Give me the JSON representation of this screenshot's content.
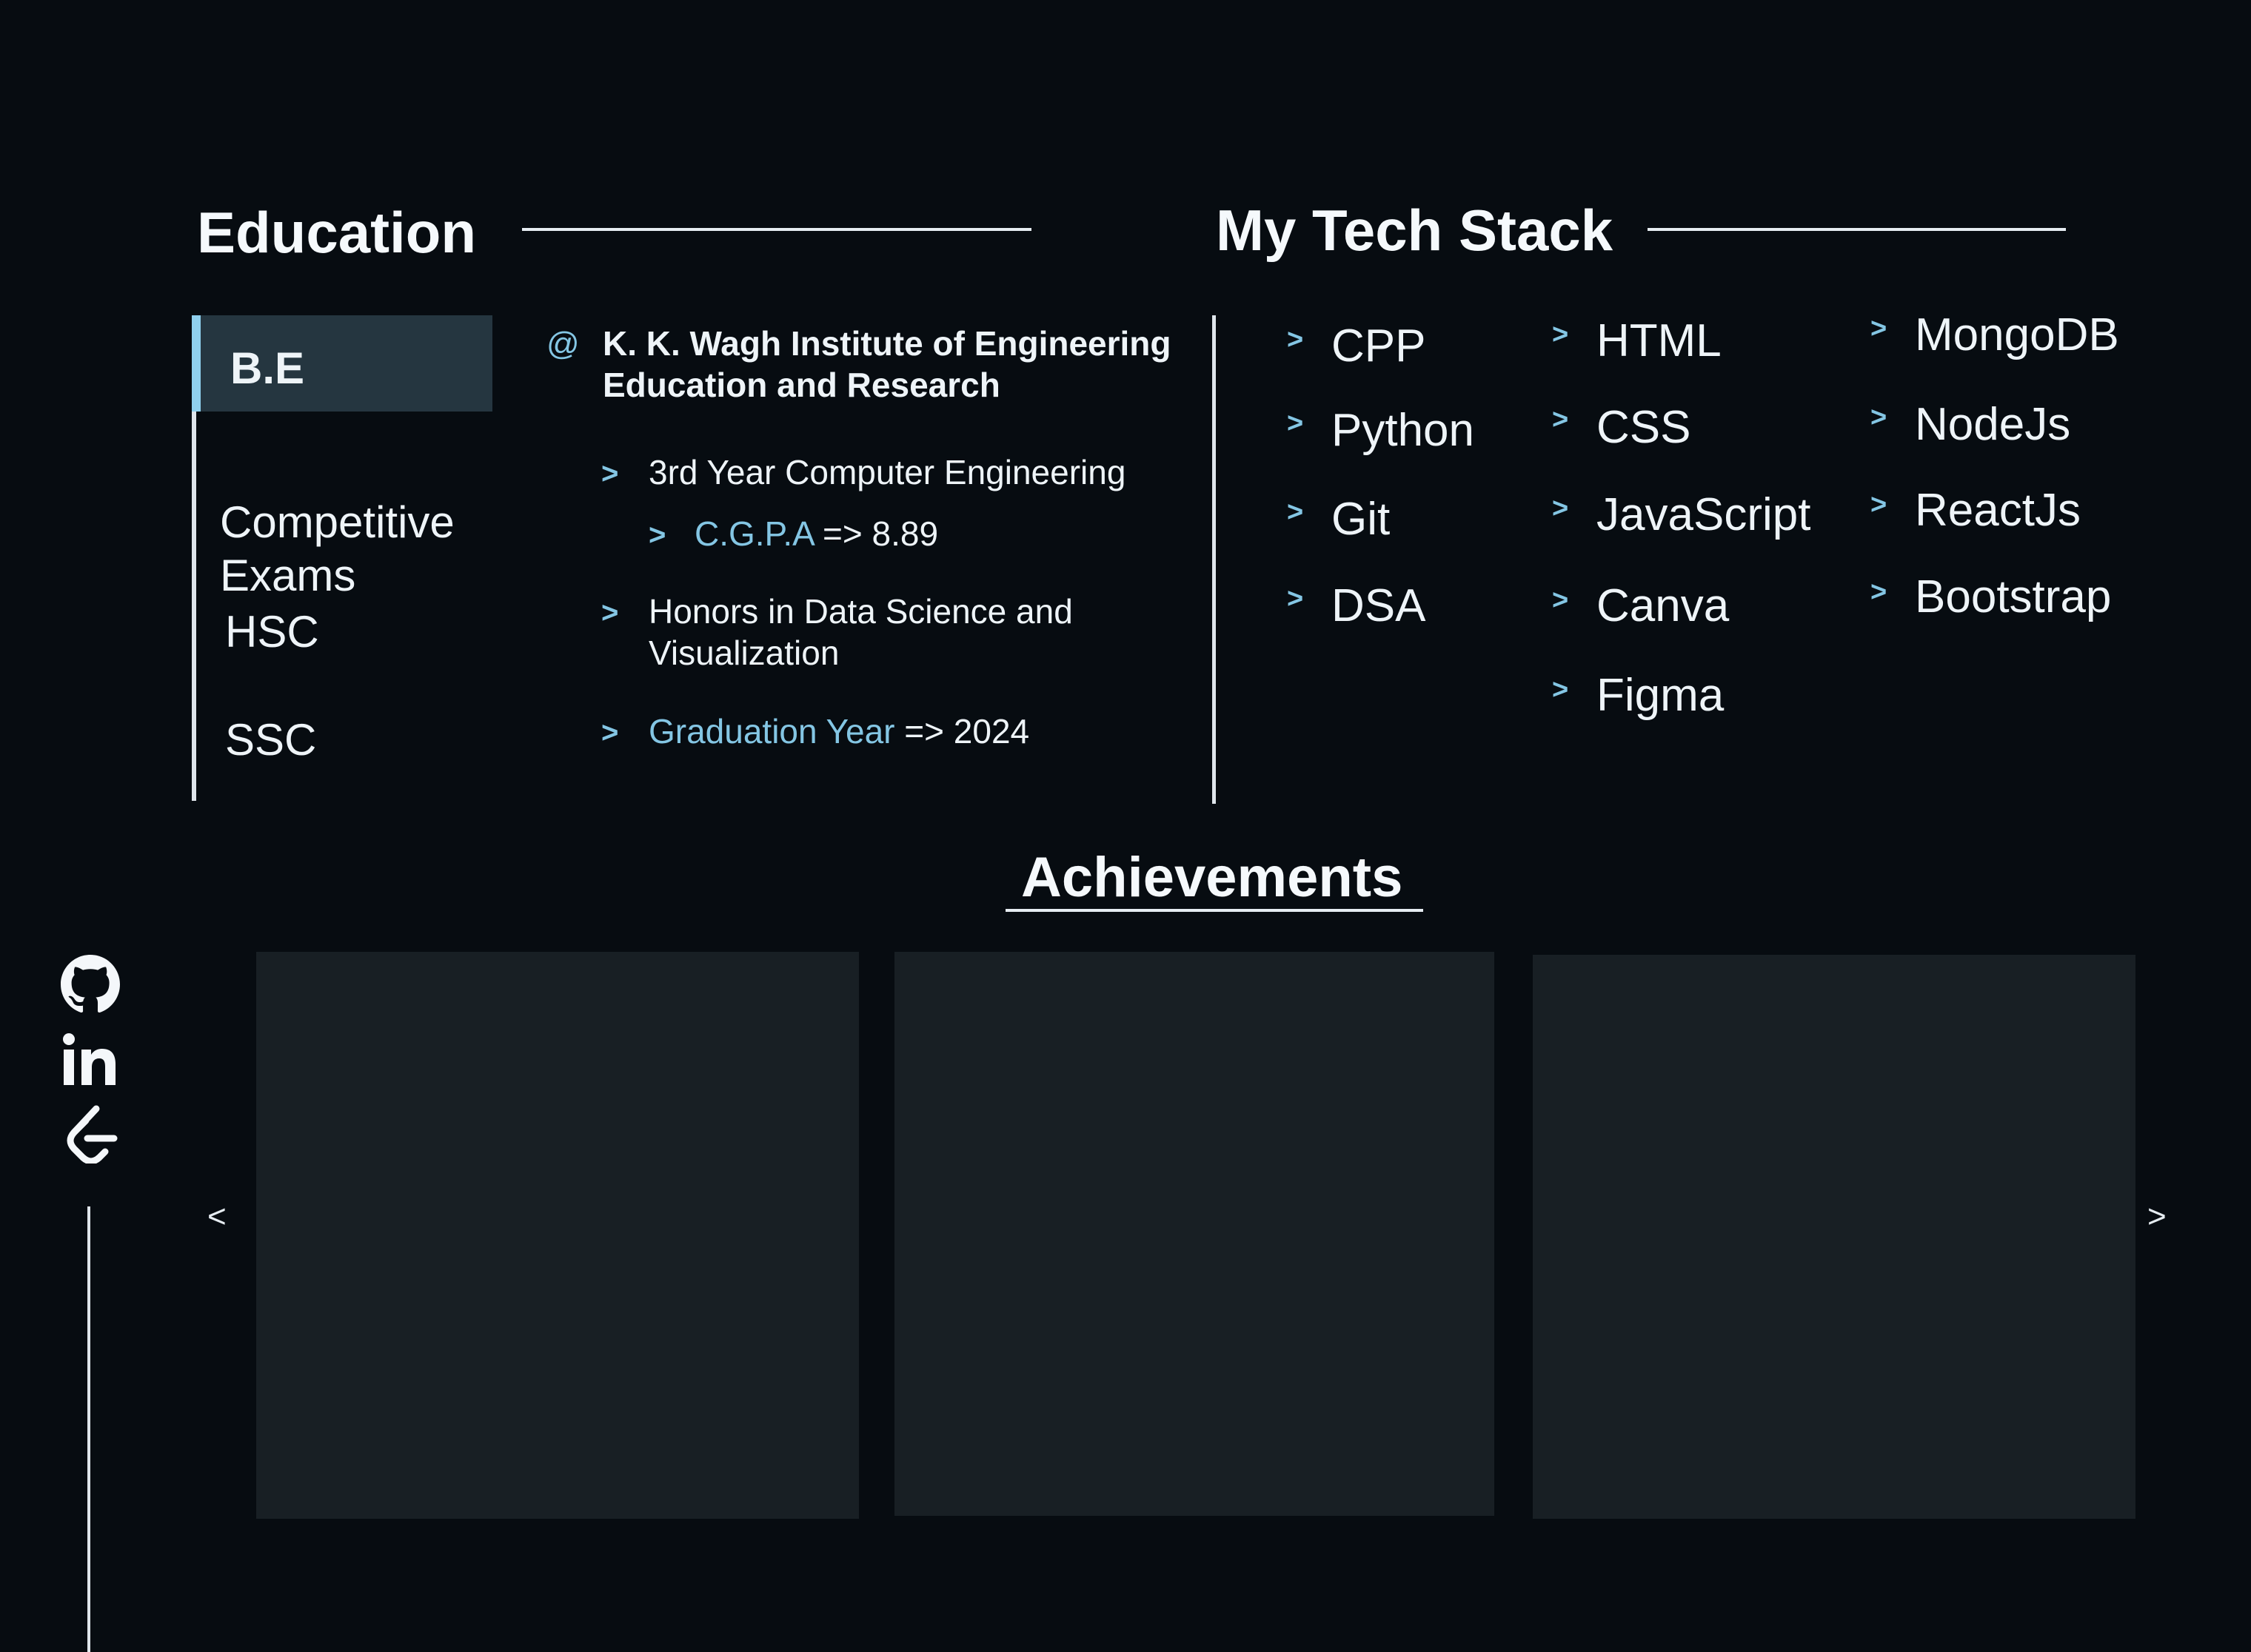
{
  "education": {
    "title": "Education",
    "tabs": [
      {
        "label": "B.E",
        "active": true
      },
      {
        "label": "Competitive\nExams",
        "active": false
      },
      {
        "label": "HSC",
        "active": false
      },
      {
        "label": "SSC",
        "active": false
      }
    ],
    "at_symbol": "@",
    "institute": "K. K. Wagh Institute of Engineering Education and Research",
    "details": {
      "year": "3rd Year Computer Engineering",
      "cgpa_label": "C.G.P.A",
      "cgpa_value": " => 8.89",
      "honors": "Honors in Data Science and Visualization",
      "grad_label": "Graduation Year",
      "grad_value": " => 2024"
    }
  },
  "tech_stack": {
    "title": "My Tech Stack",
    "col1": [
      "CPP",
      "Python",
      "Git",
      "DSA"
    ],
    "col2": [
      "HTML",
      "CSS",
      "JavaScript",
      "Canva",
      "Figma"
    ],
    "col3": [
      "MongoDB",
      "NodeJs",
      "ReactJs",
      "Bootstrap"
    ]
  },
  "achievements": {
    "title": "Achievements",
    "prev": "<",
    "next": ">"
  },
  "social": [
    "github-icon",
    "linkedin-icon",
    "leetcode-icon"
  ],
  "colors": {
    "background": "#070c11",
    "accent": "#84c6e4",
    "active_tab": "#253640",
    "card": "#181f24"
  }
}
